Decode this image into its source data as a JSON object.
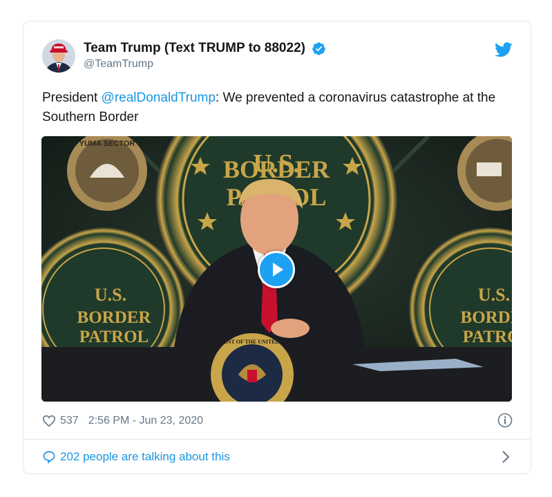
{
  "tweet": {
    "display_name": "Team Trump (Text TRUMP to 88022)",
    "handle": "@TeamTrump",
    "text_before": "President ",
    "mention": "@realDonaldTrump",
    "text_after": ": We prevented a coronavirus catastrophe at the Southern Border",
    "likes": "537",
    "timestamp": "2:56 PM - Jun 23, 2020",
    "talking": "202 people are talking about this"
  },
  "media": {
    "seal_top_line": "U.S.",
    "seal_mid_line": "BORDER",
    "seal_bottom_line": "PATROL",
    "sector_text": "YUMA SECTOR",
    "presidential_seal_text": "PRESIDENT OF THE UNITED STATES"
  },
  "icons": {
    "verified": "verified-badge-icon",
    "brand": "twitter-bird-icon",
    "play": "play-icon",
    "like": "heart-icon",
    "info": "info-icon",
    "reply": "speech-bubble-icon",
    "more": "chevron-right-icon"
  },
  "colors": {
    "link": "#1b95e0",
    "brand": "#1da1f2",
    "muted": "#657786"
  }
}
